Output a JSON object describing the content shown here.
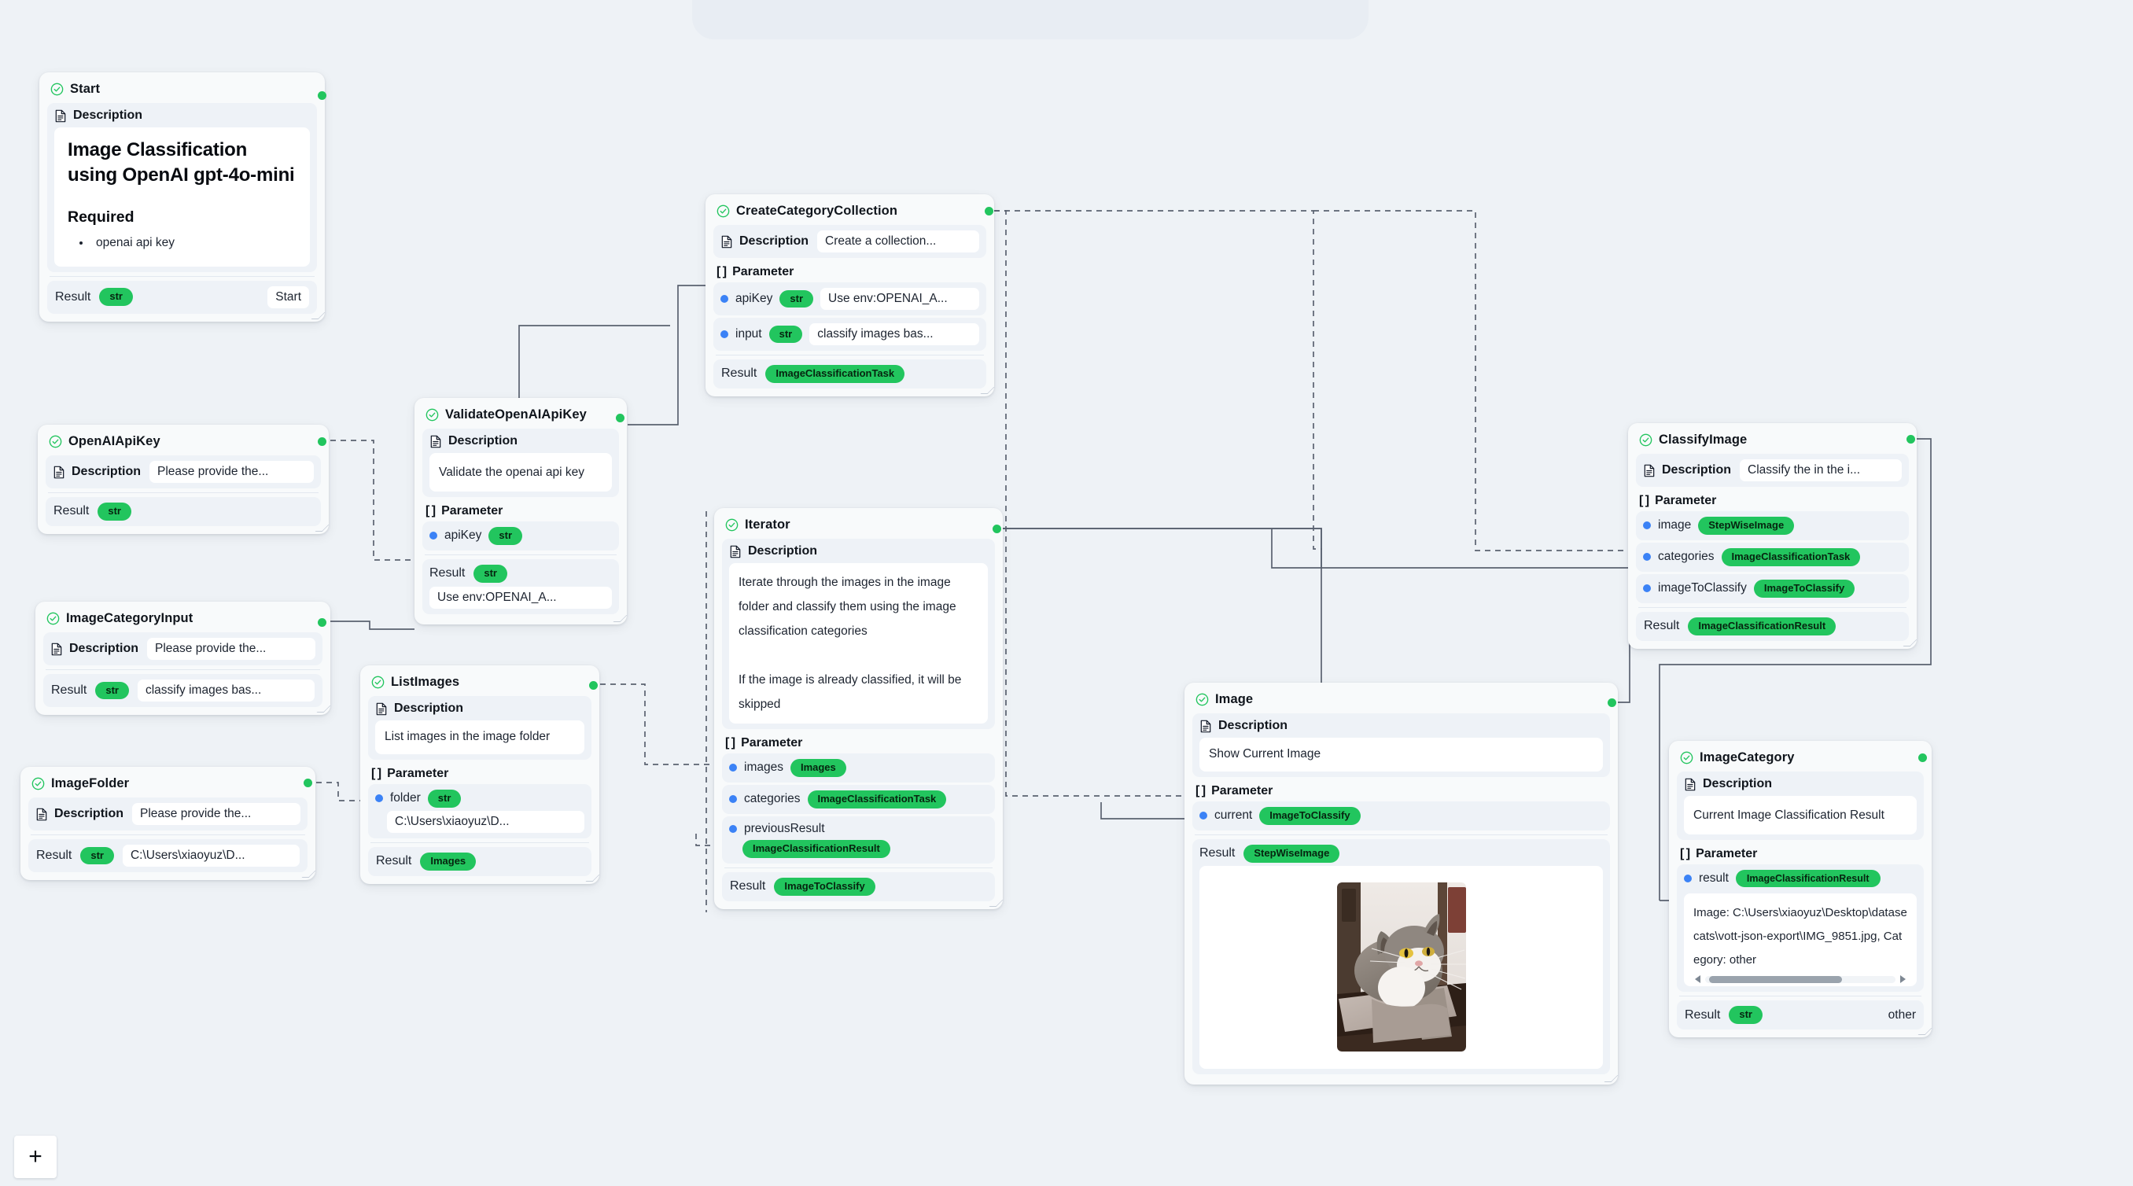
{
  "canvas": {
    "background_color": "#eef2f6",
    "add_button_label": "+",
    "add_button_icon": "plus-icon"
  },
  "labels": {
    "description": "Description",
    "parameter": "Parameter",
    "parameter_bracket": "[ ]",
    "result": "Result",
    "check_icon": "check-circle-icon",
    "doc_icon": "document-icon"
  },
  "colors": {
    "accent_green": "#22c55e",
    "port_in_blue": "#3b82f6",
    "node_bg": "#f8fafb",
    "section_bg": "#eef2f7",
    "edge": "#5a6270"
  },
  "nodes": {
    "start": {
      "title": "Start",
      "description_label": "Description",
      "heading": "Image Classification using OpenAI gpt-4o-mini",
      "required_heading": "Required",
      "required_items": [
        "openai api key"
      ],
      "result_label": "Result",
      "result_type": "str",
      "result_value": "Start"
    },
    "openai_api_key": {
      "title": "OpenAIApiKey",
      "description_label": "Description",
      "description_value": "Please provide the...",
      "result_label": "Result",
      "result_type": "str"
    },
    "image_category_input": {
      "title": "ImageCategoryInput",
      "description_label": "Description",
      "description_value": "Please provide the...",
      "result_label": "Result",
      "result_type": "str",
      "result_value": "classify images bas..."
    },
    "image_folder": {
      "title": "ImageFolder",
      "description_label": "Description",
      "description_value": "Please provide the...",
      "result_label": "Result",
      "result_type": "str",
      "result_value": "C:\\Users\\xiaoyuz\\D..."
    },
    "validate_openai_api_key": {
      "title": "ValidateOpenAIApiKey",
      "description_label": "Description",
      "description_value": "Validate the openai api key",
      "parameter_label": "Parameter",
      "parameters": [
        {
          "name": "apiKey",
          "type": "str"
        }
      ],
      "result_label": "Result",
      "result_type": "str",
      "result_value": "Use env:OPENAI_A..."
    },
    "list_images": {
      "title": "ListImages",
      "description_label": "Description",
      "description_value": "List images in the image folder",
      "parameter_label": "Parameter",
      "parameters": [
        {
          "name": "folder",
          "type": "str",
          "value": "C:\\Users\\xiaoyuz\\D..."
        }
      ],
      "result_label": "Result",
      "result_type": "Images"
    },
    "create_category_collection": {
      "title": "CreateCategoryCollection",
      "description_label": "Description",
      "description_value": "Create a collection...",
      "parameter_label": "Parameter",
      "parameters": [
        {
          "name": "apiKey",
          "type": "str",
          "value": "Use env:OPENAI_A..."
        },
        {
          "name": "input",
          "type": "str",
          "value": "classify images bas..."
        }
      ],
      "result_label": "Result",
      "result_type": "ImageClassificationTask"
    },
    "iterator": {
      "title": "Iterator",
      "description_label": "Description",
      "description_value": "Iterate through the images in the image folder and classify them using the image classification categories\n\nIf the image is already classified, it will be skipped",
      "parameter_label": "Parameter",
      "parameters": [
        {
          "name": "images",
          "type": "Images"
        },
        {
          "name": "categories",
          "type": "ImageClassificationTask"
        },
        {
          "name": "previousResult",
          "type": "ImageClassificationResult"
        }
      ],
      "result_label": "Result",
      "result_type": "ImageToClassify"
    },
    "image": {
      "title": "Image",
      "description_label": "Description",
      "description_value": "Show Current Image",
      "parameter_label": "Parameter",
      "parameters": [
        {
          "name": "current",
          "type": "ImageToClassify"
        }
      ],
      "result_label": "Result",
      "result_type": "StepWiseImage",
      "result_image_alt": "grey and white cat sitting on a cushioned chair"
    },
    "classify_image": {
      "title": "ClassifyImage",
      "description_label": "Description",
      "description_value": "Classify the in the i...",
      "parameter_label": "Parameter",
      "parameters": [
        {
          "name": "image",
          "type": "StepWiseImage"
        },
        {
          "name": "categories",
          "type": "ImageClassificationTask"
        },
        {
          "name": "imageToClassify",
          "type": "ImageToClassify"
        }
      ],
      "result_label": "Result",
      "result_type": "ImageClassificationResult"
    },
    "image_category": {
      "title": "ImageCategory",
      "description_label": "Description",
      "description_value": "Current Image Classification Result",
      "parameter_label": "Parameter",
      "parameters": [
        {
          "name": "result",
          "type": "ImageClassificationResult"
        }
      ],
      "parameter_value_text": "Image: C:\\Users\\xiaoyuz\\Desktop\\datase cats\\vott-json-export\\IMG_9851.jpg, Category: other",
      "result_label": "Result",
      "result_type": "str",
      "result_value": "other"
    }
  }
}
